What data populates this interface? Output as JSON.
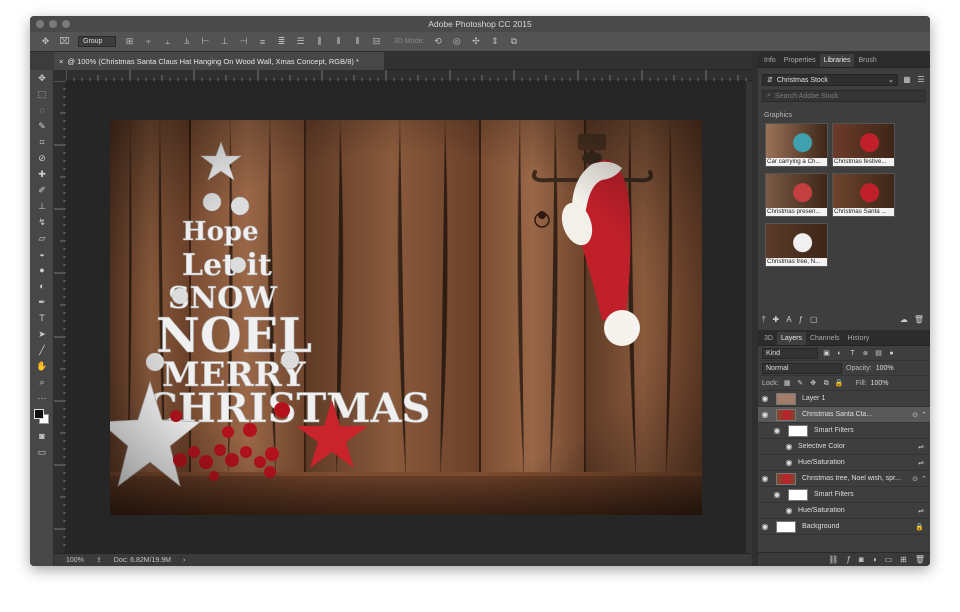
{
  "app": {
    "title": "Adobe Photoshop CC 2015"
  },
  "options_bar": {
    "auto_select_value": "Group",
    "mode_3d_label": "3D Mode:"
  },
  "document": {
    "tab_title": "@ 100% (Christmas Santa Claus Hat Hanging On Wood Wall, Xmas Concept, RGB/8) *",
    "tab_close": "×",
    "zoom": "100%",
    "doc_info": "Doc: 6.82M/19.9M",
    "status_arrow": "›"
  },
  "artwork": {
    "tree_words": [
      "Hope",
      "Let it",
      "SNOW",
      "NOEL",
      "MERRY",
      "CHRISTMAS"
    ]
  },
  "panels": {
    "top_tabs": [
      "Info",
      "Properties",
      "Libraries",
      "Brush"
    ],
    "active_top_tab": "Libraries",
    "library_name": "Christmas Stock",
    "search_placeholder": "Search Adobe Stock",
    "graphics_heading": "Graphics",
    "graphics": [
      {
        "label": "Car carrying a Ch..."
      },
      {
        "label": "Christmas festive..."
      },
      {
        "label": "Christmas presen..."
      },
      {
        "label": "Christmas Santa ..."
      },
      {
        "label": "Christmas tree, N..."
      }
    ],
    "layer_tabs": [
      "3D",
      "Layers",
      "Channels",
      "History"
    ],
    "active_layer_tab": "Layers",
    "filter_kind": "Kind",
    "blend_mode": "Normal",
    "opacity_label": "Opacity:",
    "opacity_value": "100%",
    "lock_label": "Lock:",
    "fill_label": "Fill:",
    "fill_value": "100%",
    "layers": [
      {
        "name": "Layer 1",
        "type": "color"
      },
      {
        "name": "Christmas Santa Cla...",
        "type": "smart",
        "selected": true
      },
      {
        "name": "Smart Filters",
        "type": "filter-mask",
        "indent": 1
      },
      {
        "name": "Selective Color",
        "type": "filter",
        "indent": 2
      },
      {
        "name": "Hue/Saturation",
        "type": "filter",
        "indent": 2
      },
      {
        "name": "Christmas tree, Noel wish, spr...",
        "type": "smart"
      },
      {
        "name": "Smart Filters",
        "type": "filter-mask",
        "indent": 1
      },
      {
        "name": "Hue/Saturation",
        "type": "filter",
        "indent": 2
      },
      {
        "name": "Background",
        "type": "background"
      }
    ]
  },
  "colors": {
    "wood": "#7a4a30",
    "accent_red": "#c0202a",
    "ui_dark": "#3c3c3c"
  }
}
